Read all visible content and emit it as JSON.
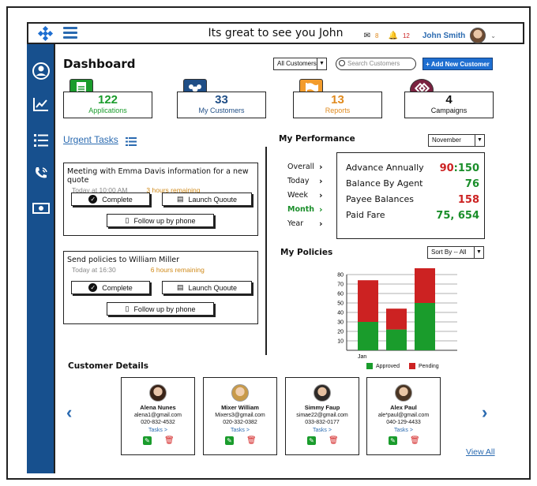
{
  "header": {
    "greeting": "Its great to see you John",
    "user_name": "John Smith",
    "mail_count": "8",
    "notif_count": "12"
  },
  "page_title": "Dashboard",
  "filters": {
    "customer_select": "All Customers",
    "search_placeholder": "Search Customers",
    "add_button": "+ Add New Customer"
  },
  "stats": [
    {
      "value": "122",
      "label": "Applications",
      "color": "#1a9c2c",
      "label_color": "#1a9c2c"
    },
    {
      "value": "33",
      "label": "My Customers",
      "color": "#1f4e86",
      "label_color": "#1f4e86"
    },
    {
      "value": "13",
      "label": "Reports",
      "color": "#e08a1e",
      "label_color": "#e08a1e"
    },
    {
      "value": "4",
      "label": "Campaigns",
      "color": "#111111",
      "label_color": "#111111"
    }
  ],
  "urgent_tasks_label": "Urgent Tasks",
  "tasks": [
    {
      "title": "Meeting with Emma Davis information for a new quote",
      "time": "Today at 10:00 AM",
      "remaining": "3 hours remaining",
      "complete": "Complete",
      "launch": "Launch Quoute",
      "follow": "Follow up by phone"
    },
    {
      "title": "Send policies to William Miller",
      "time": "Today at 16:30",
      "remaining": "6 hours remaining",
      "complete": "Complete",
      "launch": "Launch Quoute",
      "follow": "Follow up by phone"
    }
  ],
  "performance": {
    "title": "My Performance",
    "month_select": "November",
    "periods": [
      "Overall",
      "Today",
      "Week",
      "Month",
      "Year"
    ],
    "active_period": "Month",
    "rows": [
      {
        "label": "Advance Annually",
        "value_a": "90",
        "value_b": ":150",
        "color_a": "#cc2222",
        "color_b": "#1a8e2a"
      },
      {
        "label": "Balance By Agent",
        "value_a": "",
        "value_b": "76",
        "color_a": "#1a8e2a",
        "color_b": "#1a8e2a"
      },
      {
        "label": "Payee Balances",
        "value_a": "",
        "value_b": "158",
        "color_a": "#cc2222",
        "color_b": "#cc2222"
      },
      {
        "label": "Paid Fare",
        "value_a": "",
        "value_b": "75, 654",
        "color_a": "#1a8e2a",
        "color_b": "#1a8e2a"
      }
    ]
  },
  "policies": {
    "title": "My Policies",
    "sort_select": "Sort By -- All"
  },
  "chart_data": {
    "type": "bar",
    "categories": [
      "Jan",
      "",
      ""
    ],
    "series": [
      {
        "name": "Approved",
        "values": [
          30,
          22,
          50
        ],
        "color": "#1a9c2c"
      },
      {
        "name": "Pending",
        "values": [
          44,
          22,
          38
        ],
        "color": "#cc2222"
      }
    ],
    "ylim": [
      0,
      80
    ],
    "yticks": [
      10,
      20,
      30,
      40,
      50,
      60,
      70,
      80
    ],
    "stacked": true,
    "grid": true,
    "legend_position": "bottom"
  },
  "customers": {
    "title": "Customer Details",
    "view_all": "View All",
    "items": [
      {
        "name": "Alena Nunes",
        "email": "alena1@gmail.com",
        "phone": "020-832-4532",
        "tasks": "Tasks >"
      },
      {
        "name": "Mixer William",
        "email": "Mixers3@gmail.com",
        "phone": "020-332-0382",
        "tasks": "Tasks >"
      },
      {
        "name": "Simmy Faup",
        "email": "simae22@gmail.com",
        "phone": "033-832-0177",
        "tasks": "Tasks >"
      },
      {
        "name": "Alex Paul",
        "email": "ale*paul@gmail.com",
        "phone": "040-129-4433",
        "tasks": "Tasks >"
      }
    ]
  }
}
